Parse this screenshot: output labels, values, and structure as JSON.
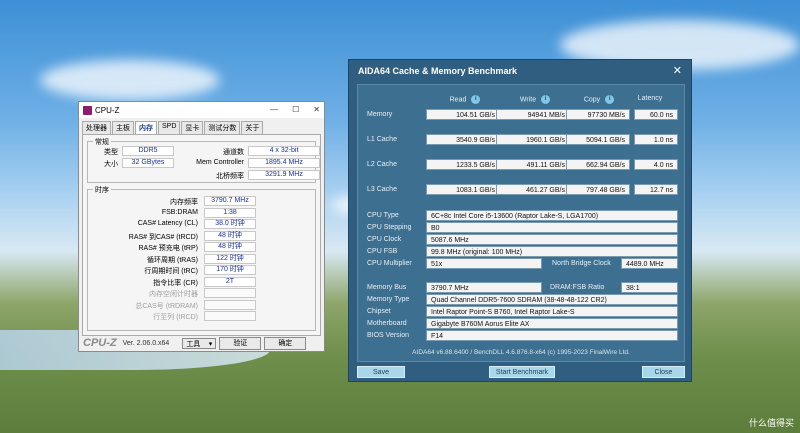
{
  "cpuz": {
    "title": "CPU-Z",
    "tabs": [
      "处理器",
      "主板",
      "内存",
      "SPD",
      "显卡",
      "测试分数",
      "关于"
    ],
    "active_tab": 2,
    "general": {
      "legend": "常规",
      "type_label": "类型",
      "type_value": "DDR5",
      "size_label": "大小",
      "size_value": "32 GBytes",
      "channels_label": "通道数",
      "channels_value": "4 x 32-bit",
      "memctrl_label": "Mem Controller",
      "memctrl_value": "1895.4 MHz",
      "nb_label": "北桥频率",
      "nb_value": "3291.9 MHz"
    },
    "timings": {
      "legend": "时序",
      "rows": [
        {
          "label": "内存频率",
          "value": "3790.7 MHz"
        },
        {
          "label": "FSB:DRAM",
          "value": "1:38"
        },
        {
          "label": "CAS# Latency (CL)",
          "value": "38.0 时钟"
        },
        {
          "label": "RAS# 到CAS# (tRCD)",
          "value": "48 时钟"
        },
        {
          "label": "RAS# 预充电 (tRP)",
          "value": "48 时钟"
        },
        {
          "label": "循环周期 (tRAS)",
          "value": "122 时钟"
        },
        {
          "label": "行周期时间 (tRC)",
          "value": "170 时钟"
        },
        {
          "label": "指令比率 (CR)",
          "value": "2T"
        },
        {
          "label": "内存空闲计时器",
          "value": ""
        },
        {
          "label": "总CAS号 (tRDRAM)",
          "value": ""
        },
        {
          "label": "行至列 (tRCD)",
          "value": ""
        }
      ]
    },
    "brand": "CPU-Z",
    "version": "Ver. 2.06.0.x64",
    "tools_label": "工具",
    "validate_label": "验证",
    "ok_label": "确定"
  },
  "aida": {
    "title": "AIDA64 Cache & Memory Benchmark",
    "headers": {
      "read": "Read",
      "write": "Write",
      "copy": "Copy",
      "latency": "Latency"
    },
    "bench_rows": [
      {
        "label": "Memory",
        "read": "104.51 GB/s",
        "write": "94941 MB/s",
        "copy": "97730 MB/s",
        "latency": "60.0 ns"
      },
      {
        "label": "L1 Cache",
        "read": "3540.9 GB/s",
        "write": "1960.1 GB/s",
        "copy": "5094.1 GB/s",
        "latency": "1.0 ns"
      },
      {
        "label": "L2 Cache",
        "read": "1233.5 GB/s",
        "write": "491.11 GB/s",
        "copy": "662.94 GB/s",
        "latency": "4.0 ns"
      },
      {
        "label": "L3 Cache",
        "read": "1083.1 GB/s",
        "write": "461.27 GB/s",
        "copy": "797.48 GB/s",
        "latency": "12.7 ns"
      }
    ],
    "cpu_type_label": "CPU Type",
    "cpu_type": "6C+8c Intel Core i5-13600  (Raptor Lake-S, LGA1700)",
    "cpu_stepping_label": "CPU Stepping",
    "cpu_stepping": "B0",
    "cpu_clock_label": "CPU Clock",
    "cpu_clock": "5087.6 MHz",
    "cpu_fsb_label": "CPU FSB",
    "cpu_fsb": "99.8 MHz  (original: 100 MHz)",
    "cpu_mult_label": "CPU Multiplier",
    "cpu_mult": "51x",
    "nb_clock_label": "North Bridge Clock",
    "nb_clock": "4489.0 MHz",
    "mem_bus_label": "Memory Bus",
    "mem_bus": "3790.7 MHz",
    "dram_ratio_label": "DRAM:FSB Ratio",
    "dram_ratio": "38:1",
    "mem_type_label": "Memory Type",
    "mem_type": "Quad Channel DDR5-7600 SDRAM  (38-48-48-122 CR2)",
    "chipset_label": "Chipset",
    "chipset": "Intel Raptor Point-S B760, Intel Raptor Lake-S",
    "mobo_label": "Motherboard",
    "mobo": "Gigabyte B760M Aorus Elite AX",
    "bios_label": "BIOS Version",
    "bios": "F14",
    "footer": "AIDA64 v6.88.6400 / BenchDLL 4.6.876.8-x64  (c) 1995-2023 FinalWire Ltd.",
    "save_label": "Save",
    "start_label": "Start Benchmark",
    "close_label": "Close"
  },
  "watermark": "什么值得买"
}
